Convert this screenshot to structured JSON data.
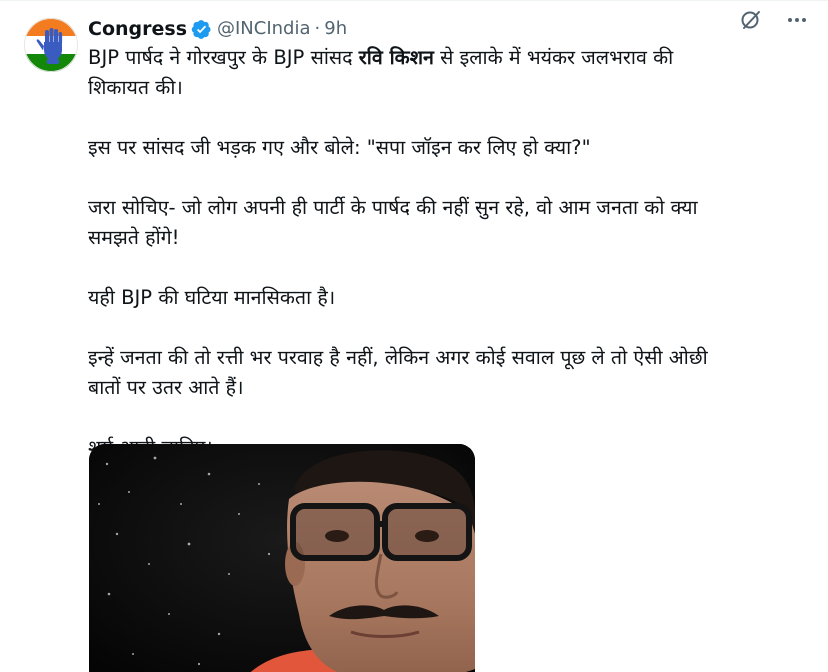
{
  "tweet": {
    "display_name": "Congress",
    "handle": "@INCIndia",
    "separator": "·",
    "time": "9h",
    "text": {
      "p1_before": "BJP पार्षद ने गोरखपुर के BJP सांसद ",
      "p1_bold": "रवि किशन",
      "p1_after": " से इलाके में भयंकर जलभराव की शिकायत की।",
      "p2": "इस पर सांसद जी भड़क गए और बोले: \"सपा जॉइन कर लिए हो क्या?\"",
      "p3": "जरा सोचिए- जो लोग अपनी ही पार्टी के पार्षद की नहीं सुन रहे, वो आम जनता को क्या समझते होंगे!",
      "p4": "यही BJP की घटिया मानसिकता है।",
      "p5": "इन्हें जनता की तो रत्ती भर परवाह है नहीं, लेकिन अगर कोई सवाल पूछ ले तो ऐसी ओछी बातों पर उतर आते हैं।",
      "p6": "शर्म आनी चाहिए।"
    }
  },
  "icons": {
    "verified": "verified-badge-icon",
    "grok": "grok-icon",
    "more": "more-options-icon"
  },
  "colors": {
    "verified_blue": "#1d9bf0",
    "secondary_text": "#536471",
    "saffron": "#f47c20",
    "green": "#138808"
  }
}
